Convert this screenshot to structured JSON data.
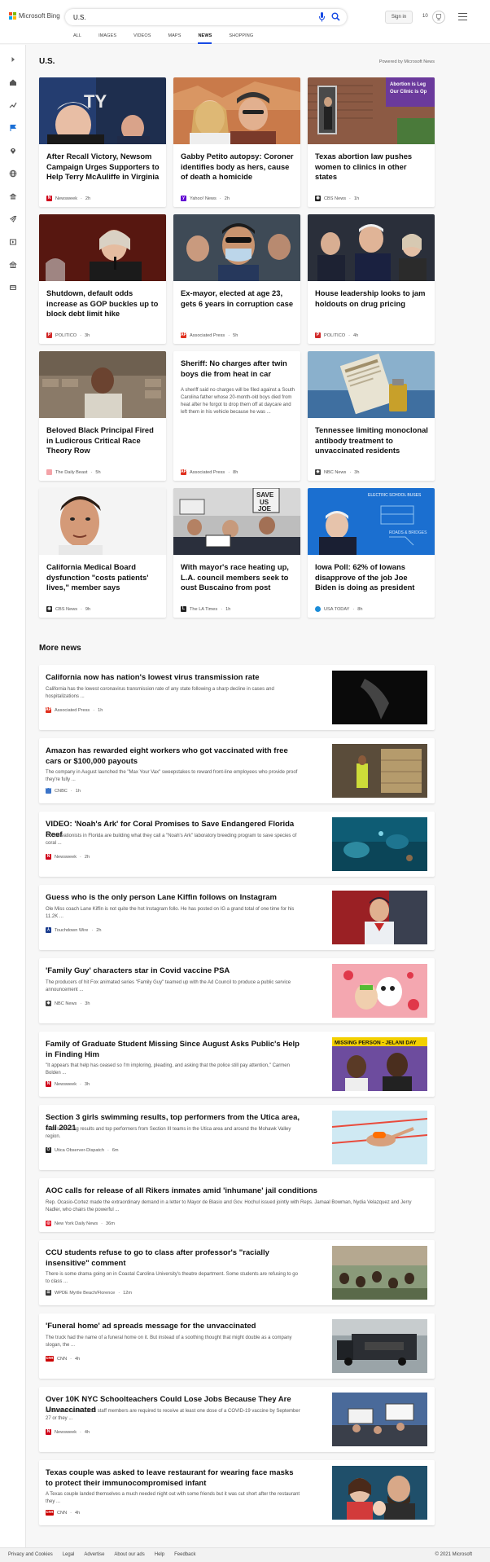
{
  "header": {
    "brand": "Microsoft Bing",
    "search_value": "U.S.",
    "signin_label": "Sign in",
    "rewards_count": "10",
    "tabs": [
      "ALL",
      "IMAGES",
      "VIDEOS",
      "MAPS",
      "NEWS",
      "SHOPPING"
    ],
    "active_tab": "NEWS"
  },
  "section": {
    "title": "U.S.",
    "powered_by": "Powered by Microsoft News"
  },
  "cards": [
    {
      "title": "After Recall Victory, Newsom Campaign Urges Supporters to Help Terry McAuliffe in Virginia",
      "source": "Newsweek",
      "time": "2h",
      "logo_color": "#d0021b",
      "logo_letter": "N"
    },
    {
      "title": "Gabby Petito autopsy: Coroner identifies body as hers, cause of death a homicide",
      "source": "Yahoo! News",
      "time": "2h",
      "logo_color": "#6001d2",
      "logo_letter": "y"
    },
    {
      "title": "Texas abortion law pushes women to clinics in other states",
      "source": "CBS News",
      "time": "1h",
      "logo_color": "#222222",
      "logo_letter": "◉"
    },
    {
      "title": "Shutdown, default odds increase as GOP buckles up to block debt limit hike",
      "source": "POLITICO",
      "time": "3h",
      "logo_color": "#d12a2a",
      "logo_letter": "P"
    },
    {
      "title": "Ex-mayor, elected at age 23, gets 6 years in corruption case",
      "source": "Associated Press",
      "time": "5h",
      "logo_color": "#e0301e",
      "logo_letter": "AP"
    },
    {
      "title": "House leadership looks to jam holdouts on drug pricing",
      "source": "POLITICO",
      "time": "4h",
      "logo_color": "#d12a2a",
      "logo_letter": "P"
    },
    {
      "title": "Beloved Black Principal Fired in Ludicrous Critical Race Theory Row",
      "source": "The Daily Beast",
      "time": "5h",
      "logo_color": "#f4a3a8",
      "logo_letter": ""
    },
    {
      "title": "Sheriff: No charges after twin boys die from heat in car",
      "description": "A sheriff said no charges will be filed against a South Carolina father whose 20-month-old boys died from heat after he forgot to drop them off at daycare and left them in his vehicle because he was ...",
      "source": "Associated Press",
      "time": "8h",
      "logo_color": "#e0301e",
      "logo_letter": "AP"
    },
    {
      "title": "Tennessee limiting monoclonal antibody treatment to unvaccinated residents",
      "source": "NBC News",
      "time": "3h",
      "logo_color": "#444444",
      "logo_letter": "◆"
    },
    {
      "title": "California Medical Board dysfunction \"costs patients' lives,\" member says",
      "source": "CBS News",
      "time": "9h",
      "logo_color": "#222222",
      "logo_letter": "◉"
    },
    {
      "title": "With mayor's race heating up, L.A. council members seek to oust Buscaino from post",
      "source": "The LA Times",
      "time": "1h",
      "logo_color": "#222222",
      "logo_letter": "L"
    },
    {
      "title": "Iowa Poll: 62% of Iowans disapprove of the job Joe Biden is doing as president",
      "source": "USA TODAY",
      "time": "8h",
      "logo_color": "#1a8cd8",
      "logo_letter": ""
    }
  ],
  "more_news": {
    "title": "More news",
    "items": [
      {
        "title": "California now has nation's lowest virus transmission rate",
        "description": "California has the lowest coronavirus transmission rate of any state following a sharp decline in cases and hospitalizations ...",
        "source": "Associated Press",
        "time": "1h",
        "logo_color": "#e0301e",
        "logo_letter": "AP"
      },
      {
        "title": "Amazon has rewarded eight workers who got vaccinated with free cars or $100,000 payouts",
        "description": "The company in August launched the \"Max Your Vax\" sweepstakes to reward front-line employees who provide proof they're fully ...",
        "source": "CNBC",
        "time": "1h",
        "logo_color": "#3b74c9",
        "logo_letter": "⌒"
      },
      {
        "title": "VIDEO: 'Noah's Ark' for Coral Promises to Save Endangered Florida Reef",
        "description": "Conservationists in Florida are building what they call a \"Noah's Ark\" laboratory breeding program to save species of coral ...",
        "source": "Newsweek",
        "time": "2h",
        "logo_color": "#d0021b",
        "logo_letter": "N"
      },
      {
        "title": "Guess who is the only person Lane Kiffin follows on Instagram",
        "description": "Ole Miss coach Lane Kiffin is not quite the hot Instagram follo. He has posted on IG a grand total of one time for his 11.2K ...",
        "source": "Touchdown Wire",
        "time": "2h",
        "logo_color": "#1b3d8f",
        "logo_letter": "⅄"
      },
      {
        "title": "'Family Guy' characters star in Covid vaccine PSA",
        "description": "The producers of hit Fox animated series \"Family Guy\" teamed up with the Ad Council to produce a public service announcement ...",
        "source": "NBC News",
        "time": "3h",
        "logo_color": "#444444",
        "logo_letter": "◆"
      },
      {
        "title": "Family of Graduate Student Missing Since August Asks Public's Help in Finding Him",
        "description": "\"It appears that help has ceased so I'm imploring, pleading, and asking that the police still pay attention,\" Carmen Bolden ...",
        "source": "Newsweek",
        "time": "3h",
        "logo_color": "#d0021b",
        "logo_letter": "N"
      },
      {
        "title": "Section 3 girls swimming results, top performers from the Utica area, fall 2021",
        "description": "Girls swimming results and top performers from Section III teams in the Utica area and around the Mohawk Valley region.",
        "source": "Utica Observer-Dispatch",
        "time": "6m",
        "logo_color": "#222222",
        "logo_letter": "O"
      },
      {
        "title": "AOC calls for release of all Rikers inmates amid 'inhumane' jail conditions",
        "description": "Rep. Ocasio-Cortez made the extraordinary demand in a letter to Mayor de Blasio and Gov. Hochul issued jointly with Reps. Jamaal Bowman, Nydia Velazquez and Jerry Nadler, who chairs the powerful ...",
        "source": "New York Daily News",
        "time": "36m",
        "logo_color": "#e21b2d",
        "logo_letter": "◎"
      },
      {
        "title": "CCU students refuse to go to class after professor's \"racially insensitive\" comment",
        "description": "There is some drama going on in Coastal Carolina University's theatre department. Some students are refusing to go to class ...",
        "source": "WPDE Myrtle Beach/Florence",
        "time": "12m",
        "logo_color": "#333333",
        "logo_letter": "☰"
      },
      {
        "title": "'Funeral home' ad spreads message for the unvaccinated",
        "description": "The truck had the name of a funeral home on it. But instead of a soothing thought that might double as a company slogan, the ...",
        "source": "CNN",
        "time": "4h",
        "logo_color": "#cc0000",
        "logo_letter": "cnn"
      },
      {
        "title": "Over 10K NYC Schoolteachers Could Lose Jobs Because They Are Unvaccinated",
        "description": "All teachers and school staff members are required to receive at least one dose of a COVID-19 vaccine by September 27 or they ...",
        "source": "Newsweek",
        "time": "4h",
        "logo_color": "#d0021b",
        "logo_letter": "N"
      },
      {
        "title": "Texas couple was asked to leave restaurant for wearing face masks to protect their immunocompromised infant",
        "description": "A Texas couple landed themselves a much needed night out with some friends but it was cut short after the restaurant they ...",
        "source": "CNN",
        "time": "4h",
        "logo_color": "#cc0000",
        "logo_letter": "cnn"
      }
    ]
  },
  "image_text": {
    "card3_sign": "Abortion is Leg... Our Clinic is Op...",
    "card11_sign": "SAVE US JOE",
    "card12_banner": "ELECTRIC SCHOOL BUSES",
    "more6_banner": "MISSING PERSON - JELANI DAY"
  },
  "footer": {
    "links": [
      "Privacy and Cookies",
      "Legal",
      "Advertise",
      "About our ads",
      "Help",
      "Feedback"
    ],
    "copyright": "© 2021 Microsoft"
  }
}
